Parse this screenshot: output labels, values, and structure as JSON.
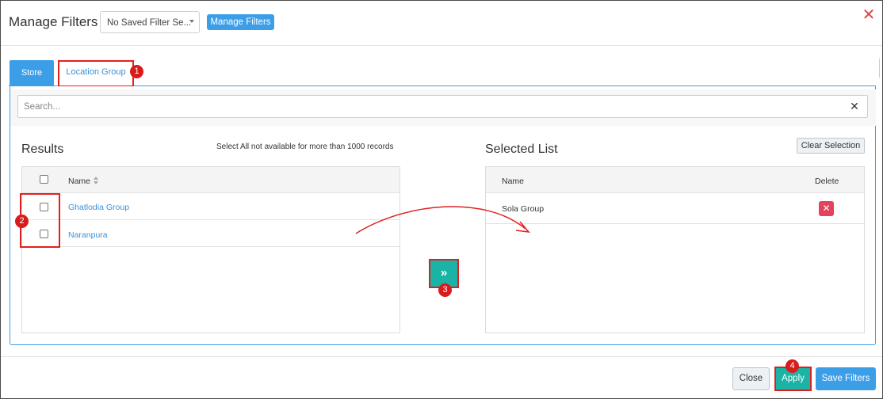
{
  "header": {
    "title": "Manage Filters",
    "saved_filter_select": "No Saved Filter Se...",
    "manage_filters_button": "Manage Filters"
  },
  "tabs": [
    {
      "label": "Store"
    },
    {
      "label": "Location Group"
    }
  ],
  "search": {
    "placeholder": "Search..."
  },
  "results": {
    "heading": "Results",
    "note": "Select All not available for more than 1000 records",
    "column_name": "Name",
    "rows": [
      {
        "name": "Ghatlodia Group",
        "checked": false
      },
      {
        "name": "Naranpura",
        "checked": false
      }
    ]
  },
  "selected": {
    "heading": "Selected List",
    "clear_button": "Clear Selection",
    "column_name": "Name",
    "column_delete": "Delete",
    "rows": [
      {
        "name": "Sola Group"
      }
    ]
  },
  "move_button": "»",
  "markers": [
    "1",
    "2",
    "3",
    "4"
  ],
  "footer": {
    "close": "Close",
    "apply": "Apply",
    "save_filters": "Save Filters"
  },
  "colors": {
    "primary_blue": "#3d9ee8",
    "teal": "#1ab3a6",
    "annotation_red": "#e02020",
    "delete_red": "#e4425d"
  }
}
